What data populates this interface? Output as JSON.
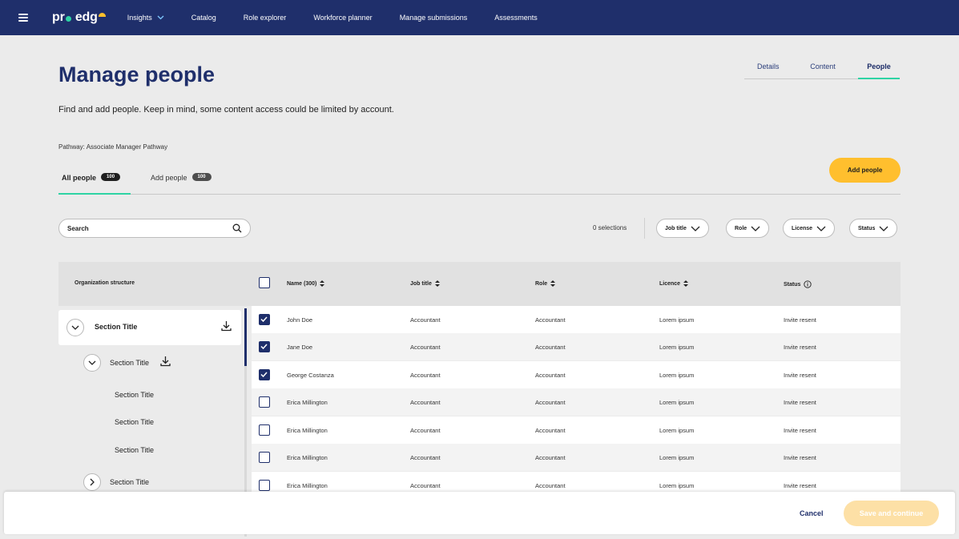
{
  "nav": {
    "logo": "pro edge",
    "logo_parts": [
      "pr",
      "edg"
    ],
    "links": [
      "Insights",
      "Catalog",
      "Role explorer",
      "Workforce planner",
      "Manage submissions",
      "Assessments"
    ],
    "accent": "#1f2f6b"
  },
  "page_tabs": [
    "Details",
    "Content",
    "People"
  ],
  "active_page_tab": "People",
  "title": "Manage people",
  "subtitle": "Find and add people. Keep in mind, some content access could be limited by account.",
  "pathway": "Pathway: Associate Manager Pathway",
  "add_people_button": "Add people",
  "subtabs": [
    {
      "label": "All people",
      "count": "100"
    },
    {
      "label": "Add people",
      "count": "100"
    }
  ],
  "search": {
    "placeholder": "Search"
  },
  "selections": "0 selections",
  "filters": [
    "Job title",
    "Role",
    "License",
    "Status"
  ],
  "table": {
    "org_label": "Organization structure",
    "columns": [
      "Name (300)",
      "Job title",
      "Role",
      "Licence",
      "Status"
    ],
    "rows": [
      {
        "name": "John Doe",
        "job": "Accountant",
        "role": "Accountant",
        "licence": "Lorem ipsum",
        "status": "Invite resent",
        "checked": true
      },
      {
        "name": "Jane Doe",
        "job": "Accountant",
        "role": "Accountant",
        "licence": "Lorem ipsum",
        "status": "Invite resent",
        "checked": true
      },
      {
        "name": "George Costanza",
        "job": "Accountant",
        "role": "Accountant",
        "licence": "Lorem ipsum",
        "status": "Invite resent",
        "checked": true
      },
      {
        "name": "Erica Millington",
        "job": "Accountant",
        "role": "Accountant",
        "licence": "Lorem ipsum",
        "status": "Invite resent",
        "checked": false
      },
      {
        "name": "Erica Millington",
        "job": "Accountant",
        "role": "Accountant",
        "licence": "Lorem ipsum",
        "status": "Invite resent",
        "checked": false
      },
      {
        "name": "Erica Millington",
        "job": "Accountant",
        "role": "Accountant",
        "licence": "Lorem ipsum",
        "status": "Invite resent",
        "checked": false
      },
      {
        "name": "Erica Millington",
        "job": "Accountant",
        "role": "Accountant",
        "licence": "Lorem ipsum",
        "status": "Invite resent",
        "checked": false
      }
    ]
  },
  "tree": [
    "Section Title",
    "Section Title",
    "Section Title",
    "Section Title",
    "Section Title",
    "Section Title"
  ],
  "footer": {
    "cancel": "Cancel",
    "save": "Save and continue"
  }
}
